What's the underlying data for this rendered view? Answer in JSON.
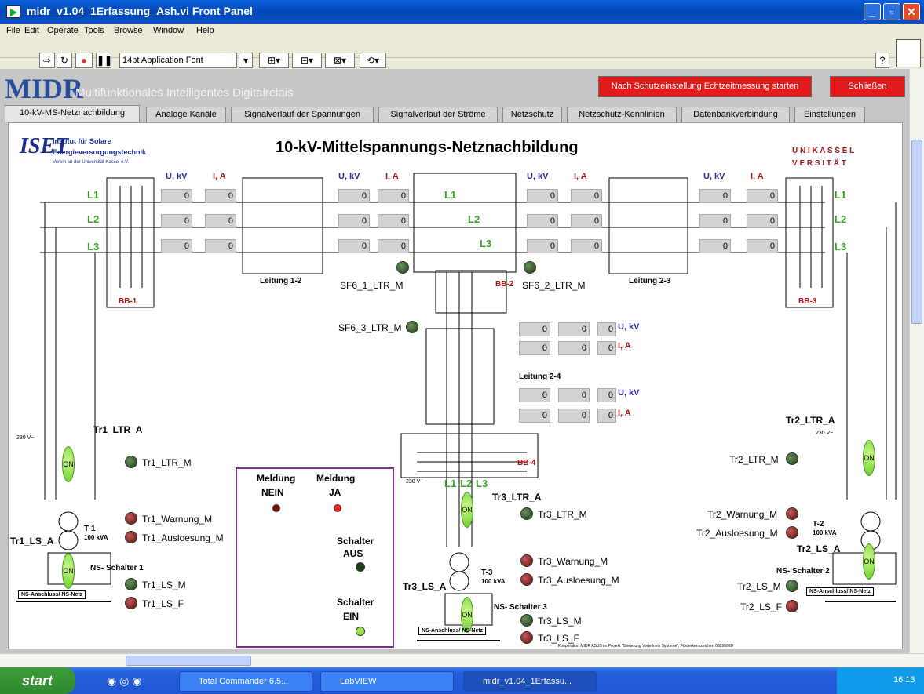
{
  "window": {
    "title": "midr_v1.04_1Erfassung_Ash.vi Front Panel",
    "minimize": "_",
    "maximize": "▫",
    "close": "✕"
  },
  "menu": [
    "File",
    "Edit",
    "Operate",
    "Tools",
    "Browse",
    "Window",
    "Help"
  ],
  "toolbar": {
    "font": "14pt Application Font"
  },
  "header": {
    "brand": "MIDR",
    "subtitle": "Multifunktionales Intelligentes Digitalrelais",
    "start_btn": "Nach Schutzeinstellung Echtzeitmessung starten",
    "close_btn": "Schließen"
  },
  "tabs": [
    "10-kV-MS-Netznachbildung",
    "Analoge Kanäle",
    "Signalverlauf der Spannungen",
    "Signalverlauf der Ströme",
    "Netzschutz",
    "Netzschutz-Kennlinien",
    "Datenbankverbindung",
    "Einstellungen"
  ],
  "diagram": {
    "title": "10-kV-Mittelspannungs-Netznachbildung",
    "iset": {
      "logo": "ISET",
      "l1": "Institut für Solare",
      "l2": "Energieversorgungstechnik",
      "l3": "Verein an der Universität Kassel e.V."
    },
    "uni": {
      "l1": "U N I K A S S E L",
      "l2": "V E R S I T Ä T"
    },
    "u_label": "U, kV",
    "i_label": "I, A",
    "phases": [
      "L1",
      "L2",
      "L3"
    ],
    "zero": "0",
    "busbars": {
      "bb1": "BB-1",
      "bb2": "BB-2",
      "bb3": "BB-3",
      "bb4": "BB-4"
    },
    "lines": {
      "l12": "Leitung 1-2",
      "l23": "Leitung 2-3",
      "l24": "Leitung 2-4"
    },
    "sf6": {
      "s1": "SF6_1_LTR_M",
      "s2": "SF6_2_LTR_M",
      "s3": "SF6_3_LTR_M"
    },
    "tr1": {
      "ltr_a": "Tr1_LTR_A",
      "ltr_m": "Tr1_LTR_M",
      "warn": "Tr1_Warnung_M",
      "ausl": "Tr1_Ausloesung_M",
      "ls_a": "Tr1_LS_A",
      "ls_m": "Tr1_LS_M",
      "ls_f": "Tr1_LS_F",
      "t": "T-1",
      "kva": "100 kVA",
      "ns": "NS- Schalter 1",
      "netz": "NS-Anschluss/ NS-Netz",
      "v": "230 V~"
    },
    "tr2": {
      "ltr_a": "Tr2_LTR_A",
      "ltr_m": "Tr2_LTR_M",
      "warn": "Tr2_Warnung_M",
      "ausl": "Tr2_Ausloesung_M",
      "ls_a": "Tr2_LS_A",
      "ls_m": "Tr2_LS_M",
      "ls_f": "Tr2_LS_F",
      "t": "T-2",
      "kva": "100 kVA",
      "ns": "NS- Schalter 2",
      "netz": "NS-Anschluss/ NS-Netz",
      "v": "230 V~"
    },
    "tr3": {
      "ltr_a": "Tr3_LTR_A",
      "ltr_m": "Tr3_LTR_M",
      "warn": "Tr3_Warnung_M",
      "ausl": "Tr3_Ausloesung_M",
      "ls_a": "Tr3_LS_A",
      "ls_m": "Tr3_LS_M",
      "ls_f": "Tr3_LS_F",
      "t": "T-3",
      "kva": "100 kVA",
      "ns": "NS- Schalter 3",
      "netz": "NS-Anschluss/ NS-Netz",
      "v": "230 V~"
    },
    "on": "ON",
    "legend": {
      "nein1": "Meldung",
      "nein2": "NEIN",
      "ja1": "Meldung",
      "ja2": "JA",
      "aus1": "Schalter",
      "aus2": "AUS",
      "ein1": "Schalter",
      "ein2": "EIN"
    },
    "footer": "Kooperation MIDR ASUS im Projekt \"Steuerung Verteilnetz Systeme\", Förderkennzeichen 0329993D"
  },
  "taskbar": {
    "start": "start",
    "t1": "Total Commander 6.5...",
    "t2": "LabVIEW",
    "t3": "midr_v1.04_1Erfassu...",
    "clock": "16:13"
  },
  "colors": {
    "title": "#0348b8",
    "red": "#e11b1b",
    "green_text": "#3aa326",
    "blue_label": "#2b2b9c",
    "red_label": "#b01818"
  }
}
